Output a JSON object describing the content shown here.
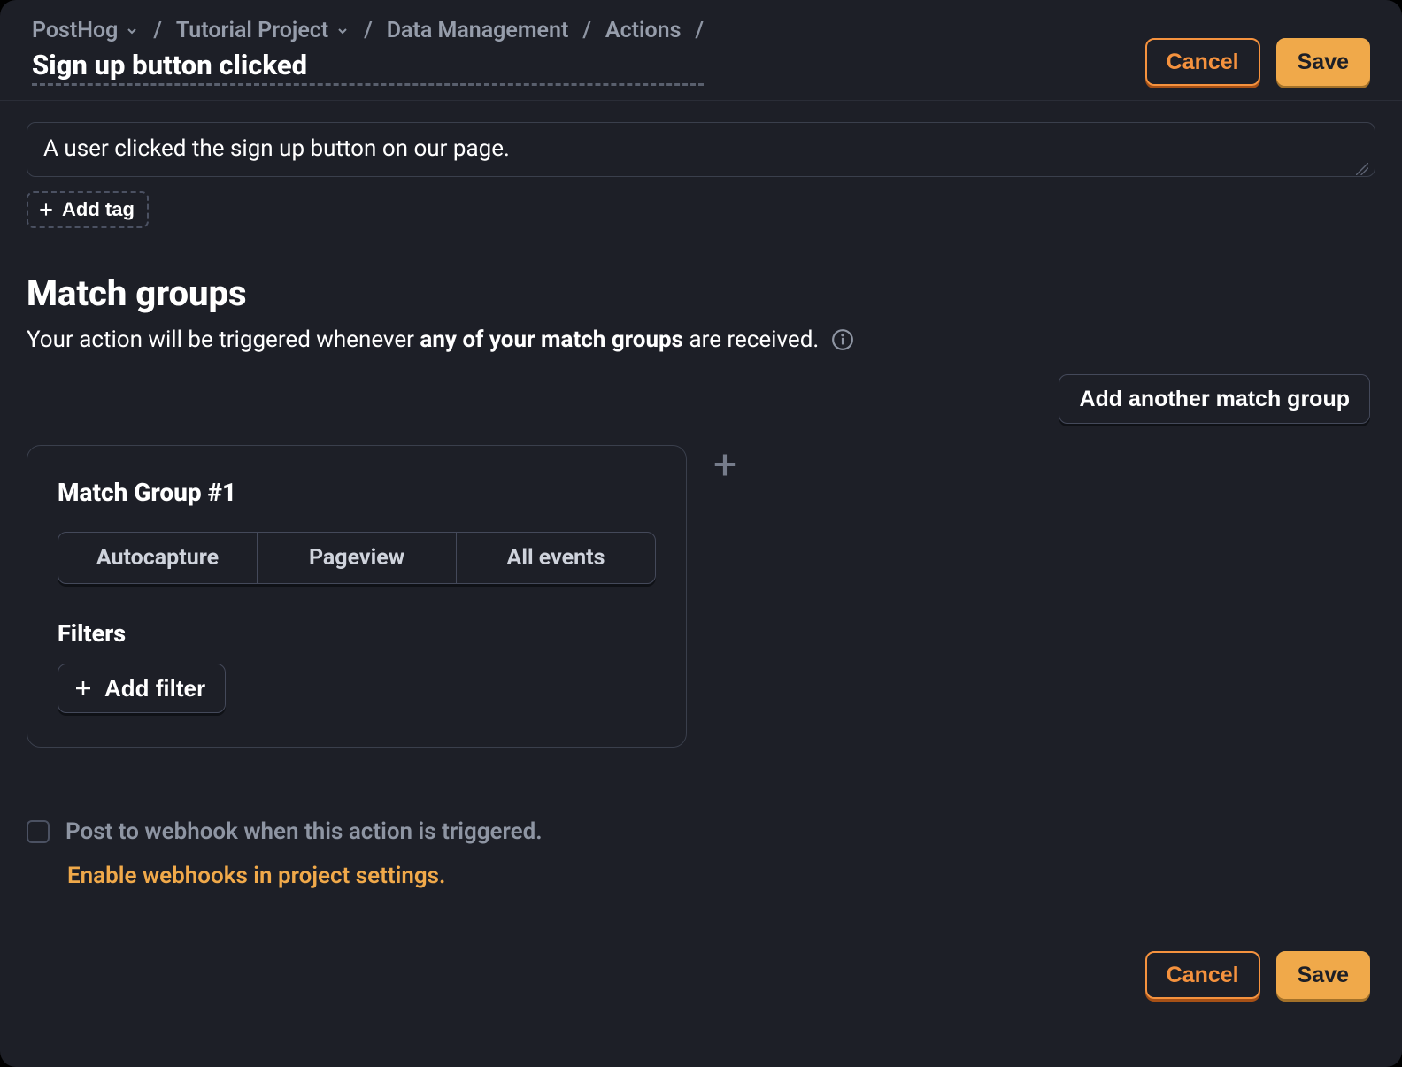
{
  "breadcrumb": {
    "org": "PostHog",
    "project": "Tutorial Project",
    "section": "Data Management",
    "subsection": "Actions"
  },
  "page_title": "Sign up button clicked",
  "header_buttons": {
    "cancel": "Cancel",
    "save": "Save"
  },
  "description": "A user clicked the sign up button on our page.",
  "add_tag_label": "Add tag",
  "match_groups": {
    "title": "Match groups",
    "description_prefix": "Your action will be triggered whenever ",
    "description_bold": "any of your match groups",
    "description_suffix": " are received.",
    "add_button": "Add another match group",
    "group": {
      "title": "Match Group #1",
      "tabs": [
        "Autocapture",
        "Pageview",
        "All events"
      ],
      "filters_title": "Filters",
      "add_filter": "Add filter"
    }
  },
  "webhook": {
    "checkbox_label": "Post to webhook when this action is triggered.",
    "settings_link": "Enable webhooks in project settings."
  },
  "footer_buttons": {
    "cancel": "Cancel",
    "save": "Save"
  }
}
